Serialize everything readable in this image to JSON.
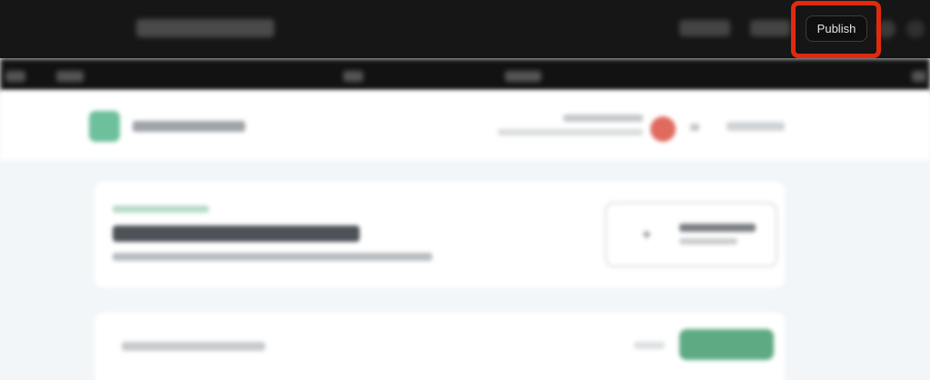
{
  "toolbar": {
    "publish_label": "Publish"
  },
  "colors": {
    "toolbar_bg": "#161616",
    "highlight": "#e02a10",
    "brand_green": "#6dc09b",
    "avatar_red": "#df6b5f"
  },
  "icons": {
    "site_logo": "logo-icon",
    "cta": "plus-icon",
    "account": "avatar",
    "menu": "chevron-down-icon"
  }
}
